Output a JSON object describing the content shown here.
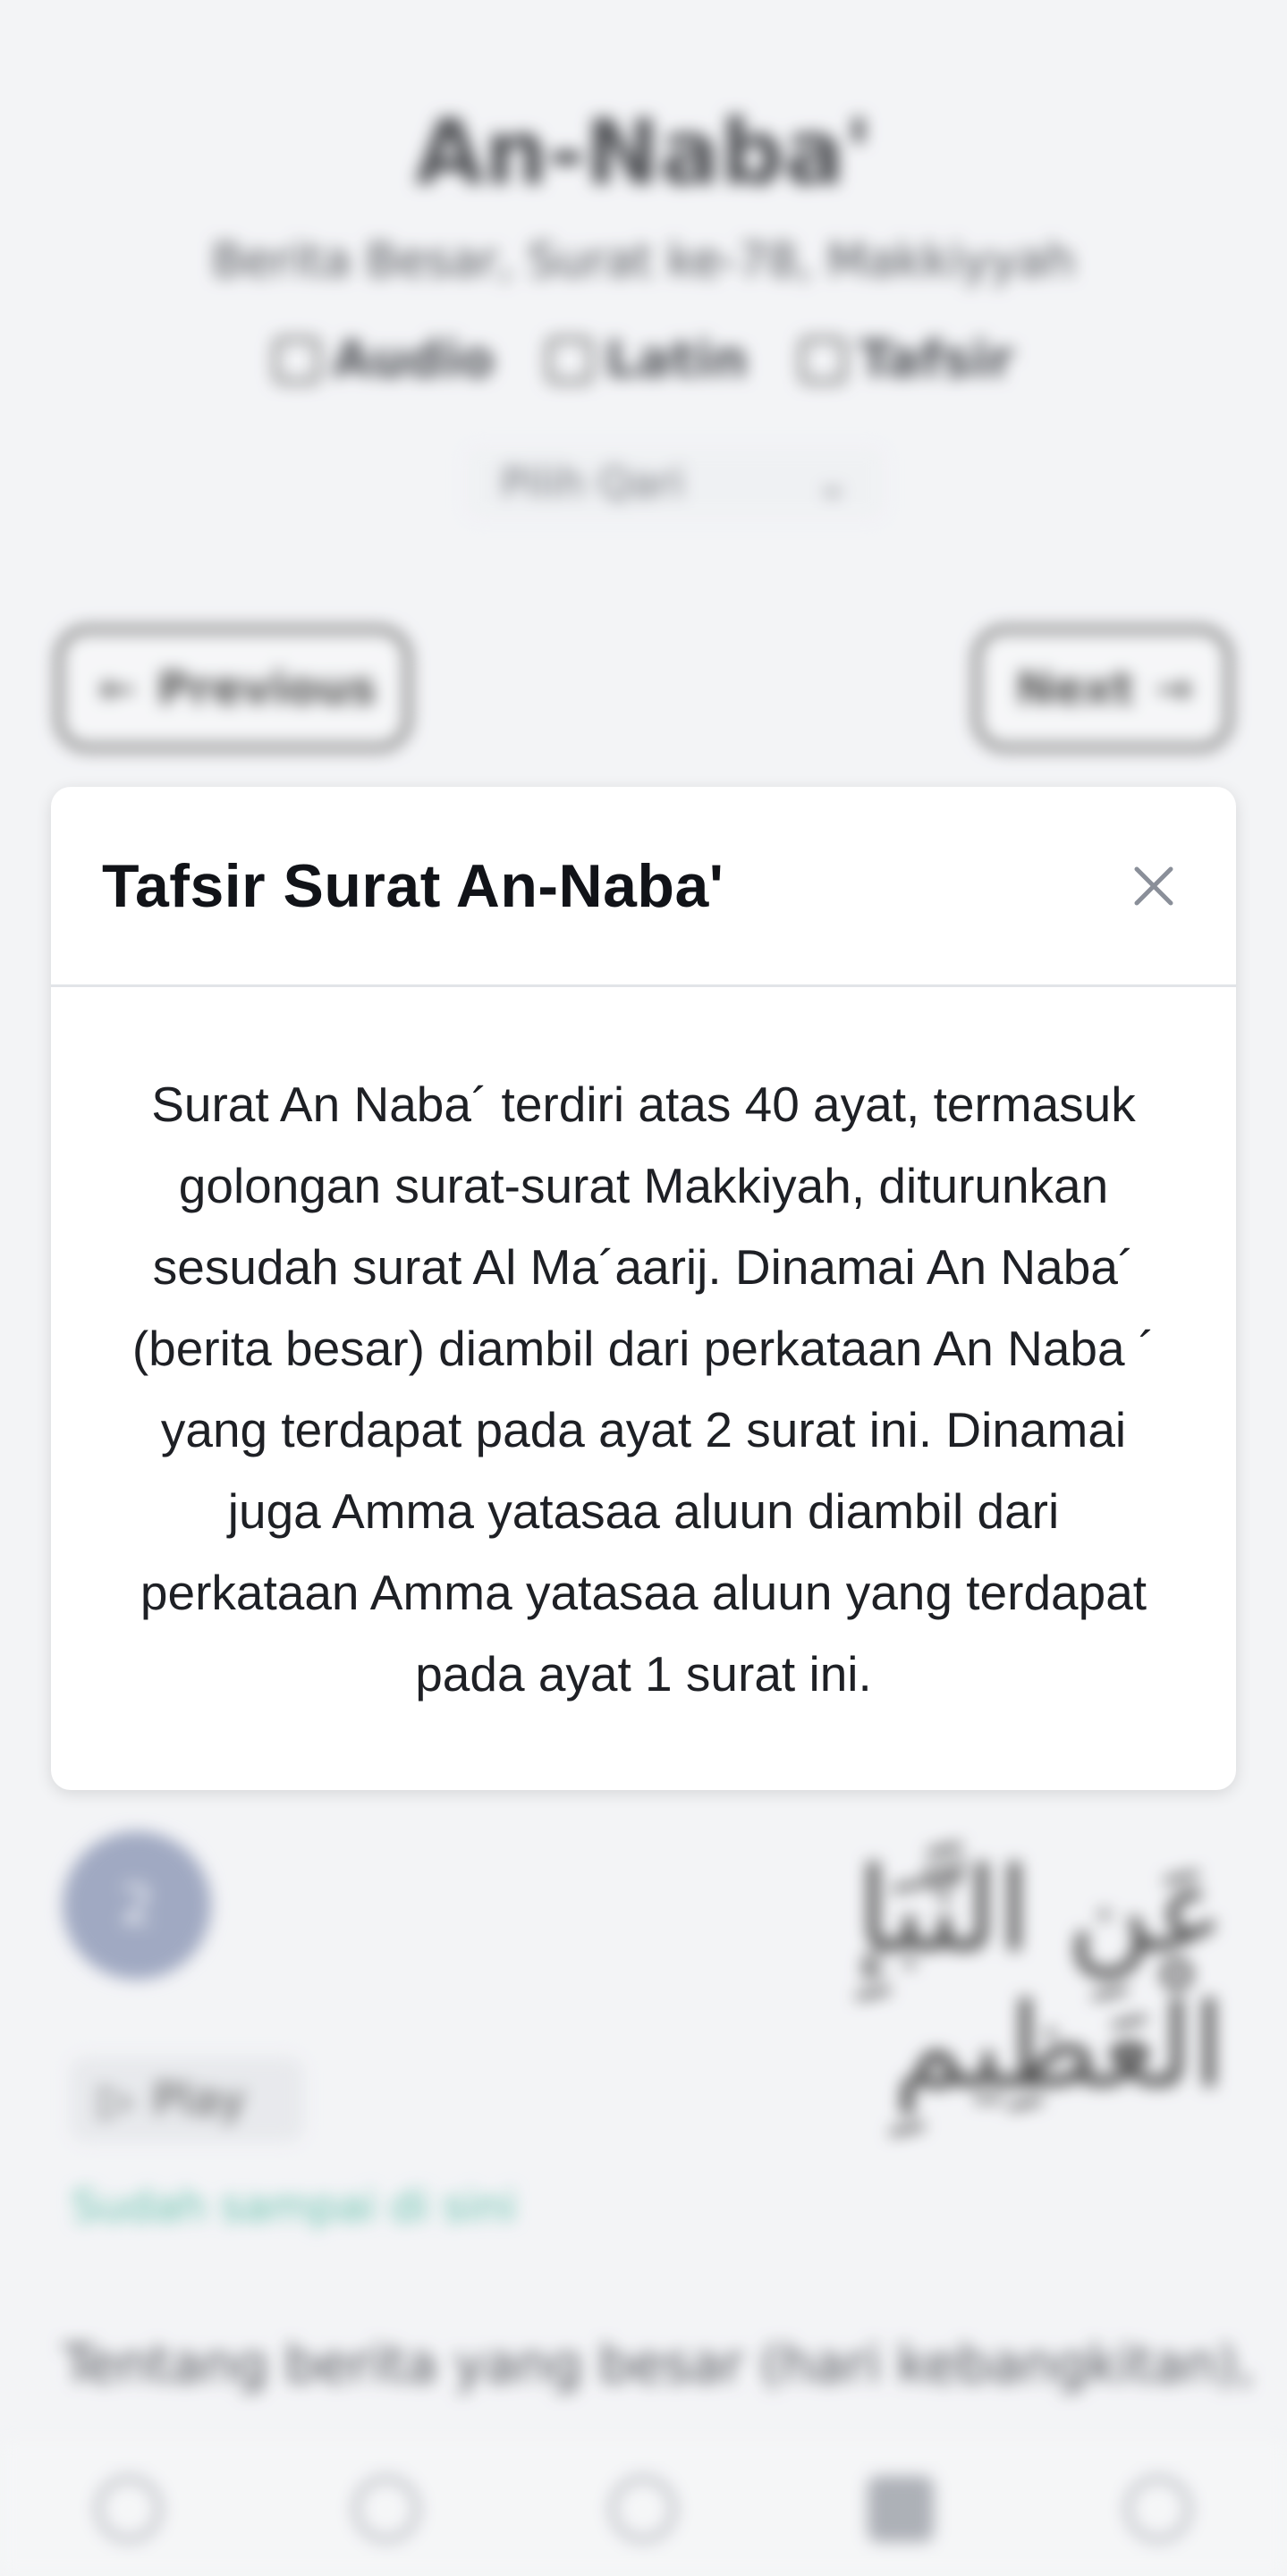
{
  "background": {
    "surah_title": "An-Naba'",
    "surah_subtitle": "Berita Besar, Surat ke-78, Makkiyyah",
    "tools": [
      {
        "icon": "speaker-icon",
        "label": "Audio"
      },
      {
        "icon": "translate-icon",
        "label": "Latin"
      },
      {
        "icon": "book-icon",
        "label": "Tafsir"
      }
    ],
    "qari_select": {
      "label": "Pilih Qari",
      "icon": "chevron-down-icon"
    },
    "nav": {
      "previous_label": "Previous",
      "next_label": "Next"
    },
    "ayah": {
      "number": "2",
      "arabic": "عَنِ النَّبَإِ الْعَظِيمِ",
      "play_label": "Play",
      "link_text": "Sudah sampai di sini",
      "translation": "Tentang berita yang besar (hari kebangkitan),"
    },
    "bottom_nav": [
      "home-icon",
      "search-icon",
      "bookmark-icon",
      "book-icon",
      "settings-icon"
    ]
  },
  "modal": {
    "title": "Tafsir Surat An-Naba'",
    "close_icon": "close-icon",
    "body": "Surat An Naba´ terdiri atas 40 ayat, termasuk golongan surat-surat Makkiyah, diturunkan sesudah surat Al Ma´aarij. Dinamai An Naba´ (berita besar) diambil dari perkataan An Naba ´ yang terdapat pada ayat 2 surat ini. Dinamai juga Amma yatasaa aluun diambil dari perkataan Amma yatasaa aluun yang terdapat pada ayat 1 surat ini.",
    "colors": {
      "title": "#111318",
      "close_icon": "#8a8f99",
      "divider": "#e2e4e8"
    }
  }
}
